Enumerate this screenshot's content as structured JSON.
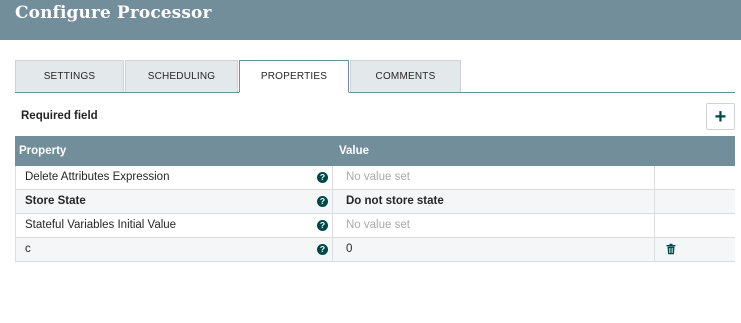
{
  "header": {
    "title": "Configure Processor"
  },
  "tabs": [
    {
      "label": "SETTINGS",
      "active": false
    },
    {
      "label": "SCHEDULING",
      "active": false
    },
    {
      "label": "PROPERTIES",
      "active": true
    },
    {
      "label": "COMMENTS",
      "active": false
    }
  ],
  "required_field_label": "Required field",
  "add_button_label": "+",
  "table": {
    "columns": {
      "property": "Property",
      "value": "Value"
    },
    "rows": [
      {
        "property": "Delete Attributes Expression",
        "value": "No value set",
        "required": false,
        "value_set": false,
        "deletable": false
      },
      {
        "property": "Store State",
        "value": "Do not store state",
        "required": true,
        "value_set": true,
        "deletable": false
      },
      {
        "property": "Stateful Variables Initial Value",
        "value": "No value set",
        "required": false,
        "value_set": false,
        "deletable": false
      },
      {
        "property": "c",
        "value": "0",
        "required": false,
        "value_set": true,
        "deletable": true
      }
    ]
  },
  "help_icon_glyph": "?",
  "icons": {
    "help": "question-circle-icon",
    "delete": "trash-icon"
  },
  "colors": {
    "header_bg": "#728e9b",
    "accent": "#004849",
    "tab_inactive_bg": "#e3e8eb",
    "unset_value": "#aaaaaa"
  }
}
